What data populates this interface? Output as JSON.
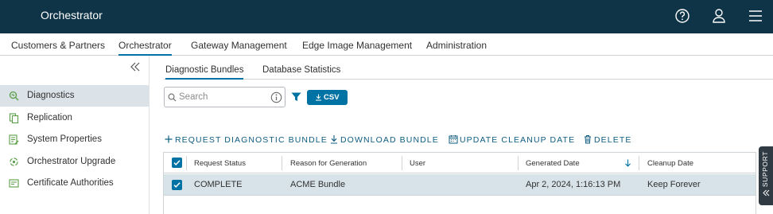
{
  "header": {
    "app_title": "Orchestrator",
    "icons": [
      "help-icon",
      "user-icon",
      "menu-icon"
    ],
    "background": "#0f3447"
  },
  "topnav": {
    "items": [
      {
        "label": "Customers & Partners"
      },
      {
        "label": "Orchestrator",
        "active": true
      },
      {
        "label": "Gateway Management"
      },
      {
        "label": "Edge Image Management"
      },
      {
        "label": "Administration"
      }
    ]
  },
  "sidebar": {
    "items": [
      {
        "label": "Diagnostics",
        "icon": "diagnostics-icon",
        "active": true
      },
      {
        "label": "Replication",
        "icon": "replication-icon"
      },
      {
        "label": "System Properties",
        "icon": "system-properties-icon"
      },
      {
        "label": "Orchestrator Upgrade",
        "icon": "upgrade-icon"
      },
      {
        "label": "Certificate Authorities",
        "icon": "certificate-icon"
      }
    ]
  },
  "tabs": [
    {
      "label": "Diagnostic Bundles",
      "active": true
    },
    {
      "label": "Database Statistics"
    }
  ],
  "toolbar": {
    "search_placeholder": "Search",
    "csv_label": "CSV",
    "accent": "#0072a3"
  },
  "actions": [
    {
      "label": "REQUEST DIAGNOSTIC BUNDLE",
      "icon": "plus-icon"
    },
    {
      "label": "DOWNLOAD BUNDLE",
      "icon": "download-icon"
    },
    {
      "label": "UPDATE CLEANUP DATE",
      "icon": "calendar-icon"
    },
    {
      "label": "DELETE",
      "icon": "trash-icon"
    }
  ],
  "table": {
    "columns": [
      "Request Status",
      "Reason for Generation",
      "User",
      "Generated Date",
      "Cleanup Date"
    ],
    "sort_column": "Generated Date",
    "sort_direction": "descending",
    "rows": [
      {
        "selected": true,
        "cells": [
          "COMPLETE",
          "ACME Bundle",
          "",
          "Apr 2, 2024, 1:16:13 PM",
          "Keep Forever"
        ]
      }
    ],
    "header_checkbox_checked": true
  },
  "support": {
    "label": "SUPPORT"
  }
}
